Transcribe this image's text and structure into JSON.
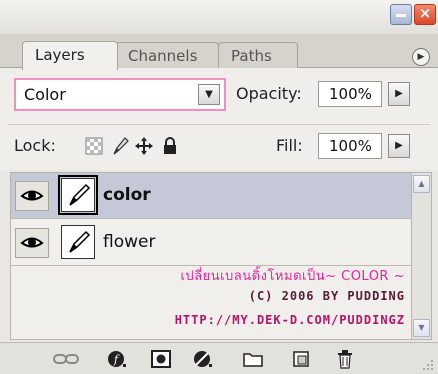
{
  "tabs": [
    {
      "label": "Layers",
      "active": true
    },
    {
      "label": "Channels",
      "active": false
    },
    {
      "label": "Paths",
      "active": false
    }
  ],
  "blend_mode": {
    "value": "Color"
  },
  "opacity": {
    "label": "Opacity:",
    "value": "100%"
  },
  "lock": {
    "label": "Lock:",
    "icons": [
      "lock-transparent-pixels-icon",
      "lock-image-pixels-icon",
      "lock-position-icon",
      "lock-all-icon"
    ]
  },
  "fill": {
    "label": "Fill:",
    "value": "100%"
  },
  "layers": [
    {
      "name": "color",
      "selected": true,
      "visible": true
    },
    {
      "name": "flower",
      "selected": false,
      "visible": true
    }
  ],
  "credits": {
    "line1": "เปลี่ยนเบลนดิ้งโหมดเป็น~ COLOR ~",
    "line2": "(C) 2006 BY PUDDING",
    "line3": "HTTP://MY.DEK-D.COM/PUDDINGZ"
  },
  "toolbar_icons": [
    "link-layers-icon",
    "layer-style-icon",
    "layer-mask-icon",
    "adjustment-layer-icon",
    "new-group-icon",
    "new-layer-icon",
    "delete-layer-icon"
  ],
  "colors": {
    "accent_pink": "#e3269a",
    "selection": "#c5c8d6",
    "panel_bg": "#efeeea"
  }
}
